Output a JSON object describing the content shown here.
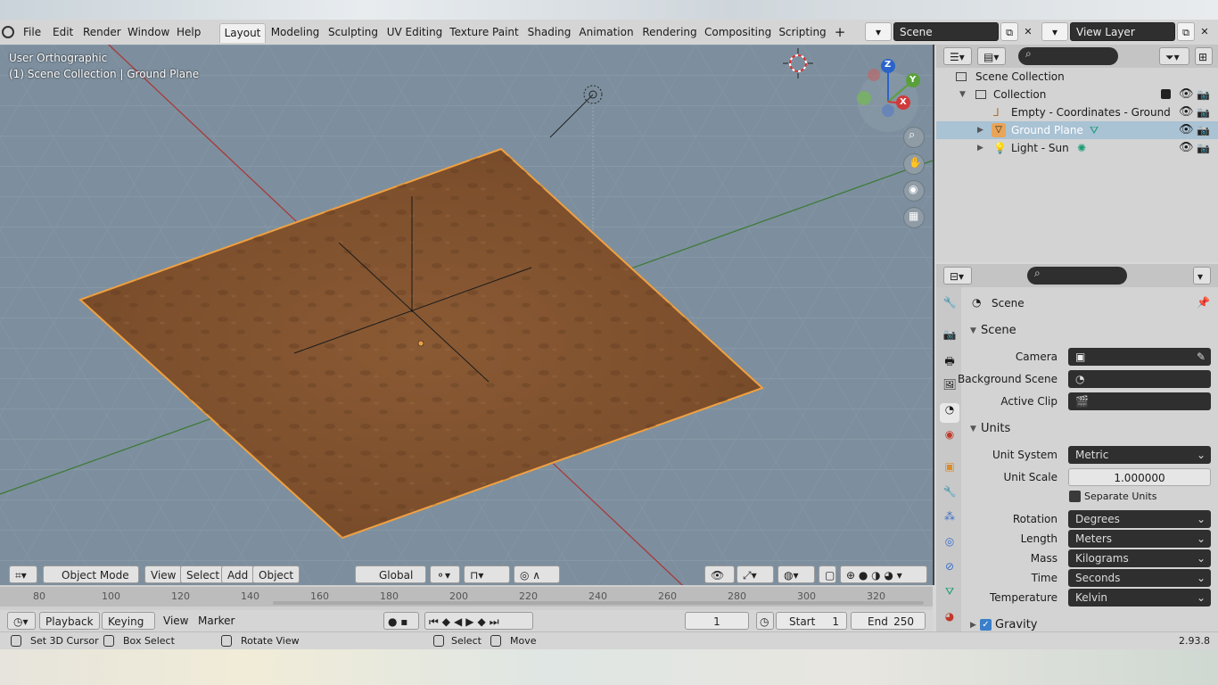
{
  "menus": [
    "File",
    "Edit",
    "Render",
    "Window",
    "Help"
  ],
  "workspace_tabs": [
    "Layout",
    "Modeling",
    "Sculpting",
    "UV Editing",
    "Texture Paint",
    "Shading",
    "Animation",
    "Rendering",
    "Compositing",
    "Scripting"
  ],
  "scene_field": "Scene",
  "view_layer_field": "View Layer",
  "viewport": {
    "view_name": "User Orthographic",
    "context": "(1) Scene Collection | Ground Plane",
    "mode": "Object Mode",
    "header_menus": [
      "View",
      "Select",
      "Add",
      "Object"
    ],
    "transform_orientation": "Global",
    "gizmo_axes": {
      "z": "Z",
      "y": "Y",
      "x": "X"
    }
  },
  "timeline": {
    "ticks": [
      "80",
      "100",
      "120",
      "140",
      "160",
      "180",
      "200",
      "220",
      "240",
      "260",
      "280",
      "300",
      "320"
    ],
    "menus": [
      "Playback",
      "Keying",
      "View",
      "Marker"
    ],
    "current_frame": "1",
    "start_label": "Start",
    "start_value": "1",
    "end_label": "End",
    "end_value": "250"
  },
  "statusbar": {
    "hint1": "Set 3D Cursor",
    "hint2": "Box Select",
    "hint3": "Rotate View",
    "hint4": "Select",
    "hint5": "Move",
    "version": "2.93.8"
  },
  "outliner": {
    "items": [
      {
        "label": "Scene Collection"
      },
      {
        "label": "Collection"
      },
      {
        "label": "Empty - Coordinates - Ground"
      },
      {
        "label": "Ground Plane"
      },
      {
        "label": "Light - Sun"
      }
    ]
  },
  "properties": {
    "context": "Scene",
    "scene_section": "Scene",
    "camera_label": "Camera",
    "bg_scene_label": "Background Scene",
    "active_clip_label": "Active Clip",
    "units_section": "Units",
    "unit_system_label": "Unit System",
    "unit_system": "Metric",
    "unit_scale_label": "Unit Scale",
    "unit_scale": "1.000000",
    "separate_units": "Separate Units",
    "rotation_label": "Rotation",
    "rotation": "Degrees",
    "length_label": "Length",
    "length": "Meters",
    "mass_label": "Mass",
    "mass": "Kilograms",
    "time_label": "Time",
    "time": "Seconds",
    "temperature_label": "Temperature",
    "temperature": "Kelvin",
    "gravity": "Gravity"
  },
  "colors": {
    "selection_outline": "#f0a040",
    "x_axis": "#c0392b",
    "y_axis": "#3e8e2f",
    "ground": "#8b5a32"
  }
}
